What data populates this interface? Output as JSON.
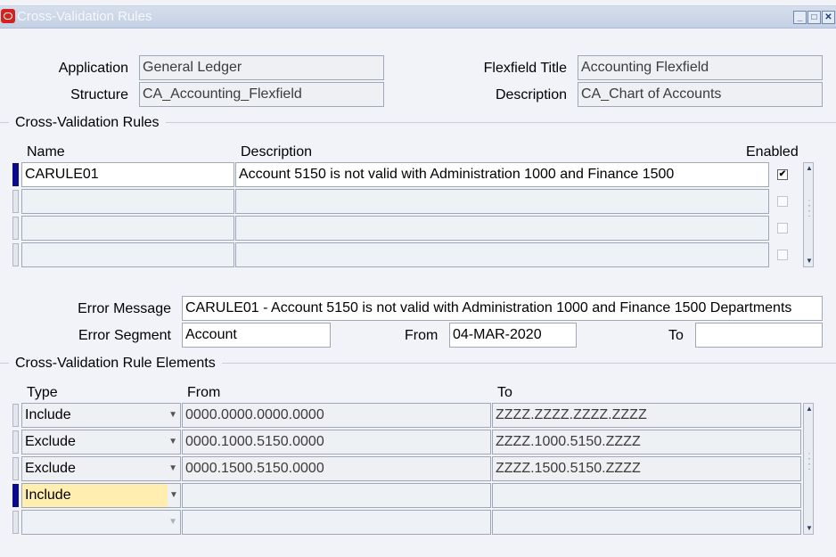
{
  "window": {
    "title": "Cross-Validation Rules"
  },
  "header": {
    "application_label": "Application",
    "application_value": "General Ledger",
    "structure_label": "Structure",
    "structure_value": "CA_Accounting_Flexfield",
    "flexfield_title_label": "Flexfield Title",
    "flexfield_title_value": "Accounting Flexfield",
    "description_label": "Description",
    "description_value": "CA_Chart of Accounts"
  },
  "rules": {
    "section_title": "Cross-Validation Rules",
    "columns": {
      "name": "Name",
      "description": "Description",
      "enabled": "Enabled"
    },
    "rows": [
      {
        "name": "CARULE01",
        "description": "Account 5150 is not valid with Administration 1000 and Finance 1500",
        "enabled": true
      },
      {
        "name": "",
        "description": "",
        "enabled": false
      },
      {
        "name": "",
        "description": "",
        "enabled": false
      },
      {
        "name": "",
        "description": "",
        "enabled": false
      }
    ],
    "checkmark": "✔"
  },
  "detail": {
    "error_message_label": "Error Message",
    "error_message_value": "CARULE01 - Account 5150 is not valid with Administration 1000 and Finance 1500 Departments",
    "error_segment_label": "Error Segment",
    "error_segment_value": "Account",
    "from_label": "From",
    "from_value": "04-MAR-2020",
    "to_label": "To",
    "to_value": ""
  },
  "elements": {
    "section_title": "Cross-Validation Rule Elements",
    "columns": {
      "type": "Type",
      "from": "From",
      "to": "To"
    },
    "rows": [
      {
        "type": "Include",
        "from": "0000.0000.0000.0000",
        "to": "ZZZZ.ZZZZ.ZZZZ.ZZZZ"
      },
      {
        "type": "Exclude",
        "from": "0000.1000.5150.0000",
        "to": "ZZZZ.1000.5150.ZZZZ"
      },
      {
        "type": "Exclude",
        "from": "0000.1500.5150.0000",
        "to": "ZZZZ.1500.5150.ZZZZ"
      },
      {
        "type": "Include",
        "from": "",
        "to": ""
      },
      {
        "type": "",
        "from": "",
        "to": ""
      }
    ]
  },
  "icons": {
    "app_icon": "oracle-logo-icon",
    "minimize": "_",
    "maximize": "□",
    "close": "✕",
    "scroll_up": "▲",
    "scroll_down": "▼",
    "dropdown": "▼"
  },
  "colors": {
    "current_row": "#0A0A8C",
    "highlight_field": "#FFEEB0",
    "title_bar": "#C4D0E4"
  }
}
